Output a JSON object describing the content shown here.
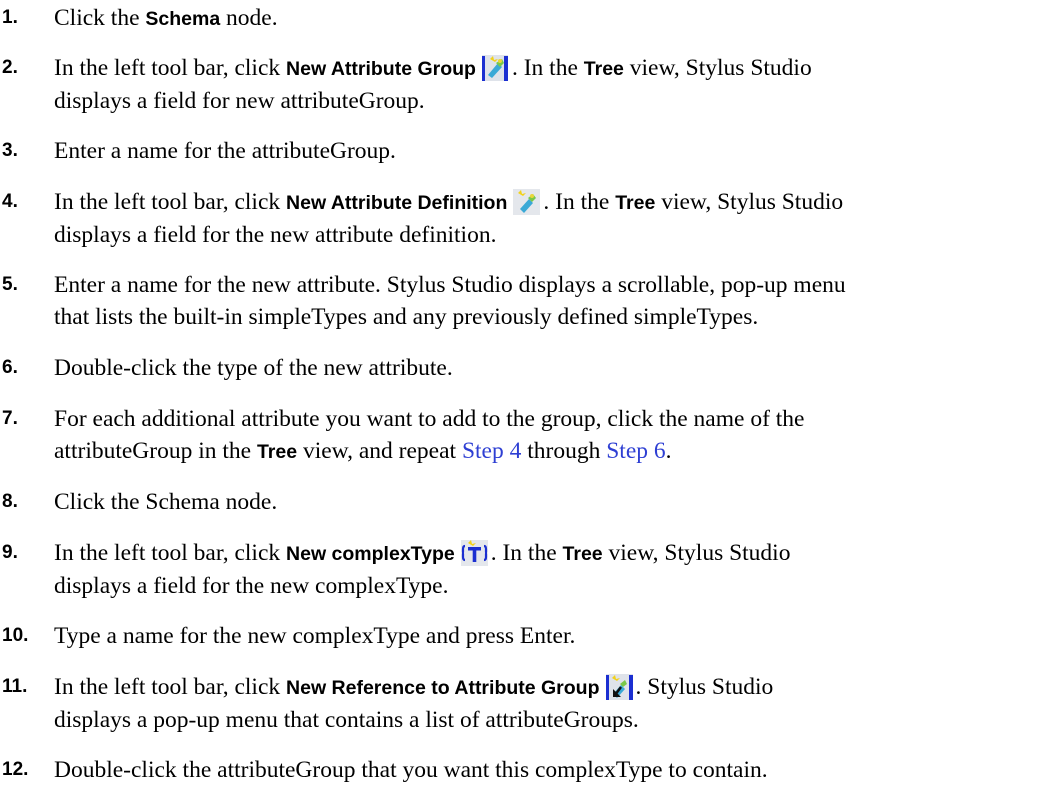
{
  "steps": [
    {
      "num": "1.",
      "pre": "Click the ",
      "ui": "Schema",
      "post": " node."
    },
    {
      "num": "2.",
      "line1_pre": "In the left tool bar, click ",
      "line1_ui": "New Attribute Group",
      "icon": "new-attribute-group-icon",
      "line1_mid": ". In the ",
      "line1_ui2": "Tree",
      "line1_post": " view, Stylus Studio",
      "line2": "displays a field for new attributeGroup."
    },
    {
      "num": "3.",
      "text": "Enter a name for the attributeGroup."
    },
    {
      "num": "4.",
      "line1_pre": "In the left tool bar, click ",
      "line1_ui": "New Attribute Definition",
      "icon": "new-attribute-definition-icon",
      "line1_mid": ". In the ",
      "line1_ui2": "Tree",
      "line1_post": " view, Stylus Studio",
      "line2": "displays a field for the new attribute definition."
    },
    {
      "num": "5.",
      "line1": "Enter a name for the new attribute. Stylus Studio displays a scrollable, pop-up menu",
      "line2": "that lists the built-in simpleTypes and any previously defined simpleTypes."
    },
    {
      "num": "6.",
      "text": "Double-click the type of the new attribute."
    },
    {
      "num": "7.",
      "line1": "For each additional attribute you want to add to the group, click the name of the",
      "line2_pre": "attributeGroup in the ",
      "line2_ui": "Tree",
      "line2_mid": " view, and repeat ",
      "link1": "Step 4",
      "line2_mid2": " through ",
      "link2": "Step 6",
      "line2_post": "."
    },
    {
      "num": "8.",
      "text": "Click the Schema node."
    },
    {
      "num": "9.",
      "line1_pre": "In the left tool bar, click ",
      "line1_ui": "New complexType",
      "icon": "new-complextype-icon",
      "line1_mid": ". In the ",
      "line1_ui2": "Tree",
      "line1_post": " view, Stylus Studio",
      "line2": "displays a field for the new complexType."
    },
    {
      "num": "10.",
      "text": "Type a name for the new complexType and press Enter."
    },
    {
      "num": "11.",
      "line1_pre": "In the left tool bar, click ",
      "line1_ui": "New Reference to Attribute Group",
      "icon": "new-reference-to-attribute-group-icon",
      "line1_post": ". Stylus Studio",
      "line2": "displays a pop-up menu that contains a list of attributeGroups."
    },
    {
      "num": "12.",
      "text": "Double-click the attributeGroup that you want this complexType to contain."
    }
  ],
  "colors": {
    "text": "#000000",
    "link": "#2e3fd3",
    "background": "#ffffff"
  }
}
